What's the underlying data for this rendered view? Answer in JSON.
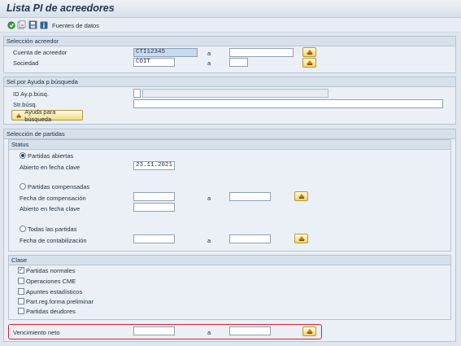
{
  "window": {
    "title": "Lista PI de acreedores"
  },
  "toolbar": {
    "sources_label": "Fuentes de datos"
  },
  "vendor_selection": {
    "heading": "Selección acreedor",
    "account_label": "Cuenta de acreedor",
    "account_value": "CTI12345",
    "company_label": "Sociedad",
    "company_value": "COIT",
    "to_label": "a"
  },
  "search_help": {
    "heading": "Sel.por Ayuda p.búsqueda",
    "id_label": "ID Ay.p.búsq.",
    "str_label": "Str.búsq.",
    "button_label": "Ayuda para búsqueda"
  },
  "items_selection": {
    "heading": "Selección de partidas",
    "status": {
      "heading": "Status",
      "open_items_label": "Partidas abiertas",
      "open_key_date_label": "Abierto en fecha clave",
      "open_key_date_value": "23.11.2021",
      "cleared_items_label": "Partidas compensadas",
      "clearing_date_label": "Fecha de compensación",
      "cleared_open_key_date_label": "Abierto en fecha clave",
      "all_items_label": "Todas las partidas",
      "posting_date_label": "Fecha de contabilización",
      "to_label": "a",
      "selected_option": "Partidas abiertas"
    },
    "type": {
      "heading": "Clase",
      "normal_items_label": "Partidas normales",
      "cme_label": "Operaciones CME",
      "statistical_label": "Apuntes estadísticos",
      "parked_label": "Part.reg.forma preliminar",
      "debtor_items_label": "Partidas deudores",
      "normal_items_checked": true
    }
  },
  "net_due": {
    "label": "Vencimiento neto",
    "to_label": "a"
  },
  "colors": {
    "highlight_frame": "#d8232a",
    "field_selected": "#c9d9ee"
  }
}
